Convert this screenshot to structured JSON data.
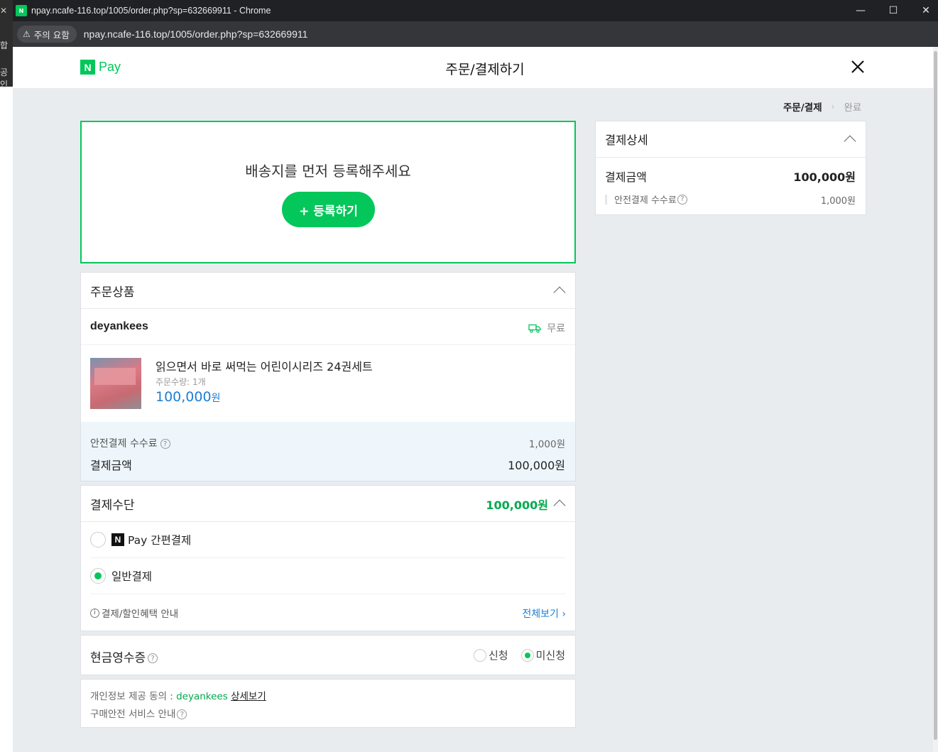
{
  "browser": {
    "window_title": "npay.ncafe-116.top/1005/order.php?sp=632669911 - Chrome",
    "security_chip": "주의 요함",
    "url": "npay.ncafe-116.top/1005/order.php?sp=632669911",
    "bg_fragments": [
      "합",
      "공인"
    ]
  },
  "header": {
    "logo_n": "N",
    "logo_pay": "Pay",
    "title": "주문/결제하기"
  },
  "steps": {
    "current": "주문/결제",
    "next": "완료"
  },
  "address": {
    "message": "배송지를 먼저 등록해주세요",
    "register_button": "+ 등록하기"
  },
  "order": {
    "section_title": "주문상품",
    "seller": "deyankees",
    "shipping": "무료",
    "item_name": "읽으면서 바로 써먹는 어린이시리즈 24권세트",
    "item_qty": "주문수량: 1개",
    "item_price": "100,000",
    "item_price_unit": "원",
    "fee_label": "안전결제 수수료",
    "fee_value": "1,000원",
    "total_label": "결제금액",
    "total_value": "100,000원"
  },
  "payment": {
    "section_title": "결제수단",
    "amount": "100,000원",
    "option_npay_logo": "N",
    "option_npay": "Pay 간편결제",
    "option_general": "일반결제",
    "selected": "일반결제",
    "benefit_text": "결제/할인혜택 안내",
    "view_all": "전체보기 ›"
  },
  "cash_receipt": {
    "title": "현금영수증",
    "opt_apply": "신청",
    "opt_none": "미신청",
    "selected": "미신청"
  },
  "privacy": {
    "consent_label": "개인정보 제공 동의 : ",
    "consent_target": "deyankees",
    "consent_link": "상세보기",
    "safe_service": "구매안전 서비스 안내"
  },
  "detail": {
    "section_title": "결제상세",
    "total_label": "결제금액",
    "total_value": "100,000원",
    "fee_label": "안전결제 수수료",
    "fee_value": "1,000원"
  },
  "colors": {
    "brand": "#03c75a",
    "link": "#1c7ed6",
    "price": "#1c7ed6"
  },
  "icons": [
    "warning-icon",
    "close-icon",
    "chevron-up-icon",
    "truck-icon",
    "help-icon",
    "info-icon",
    "chevron-right-icon"
  ]
}
